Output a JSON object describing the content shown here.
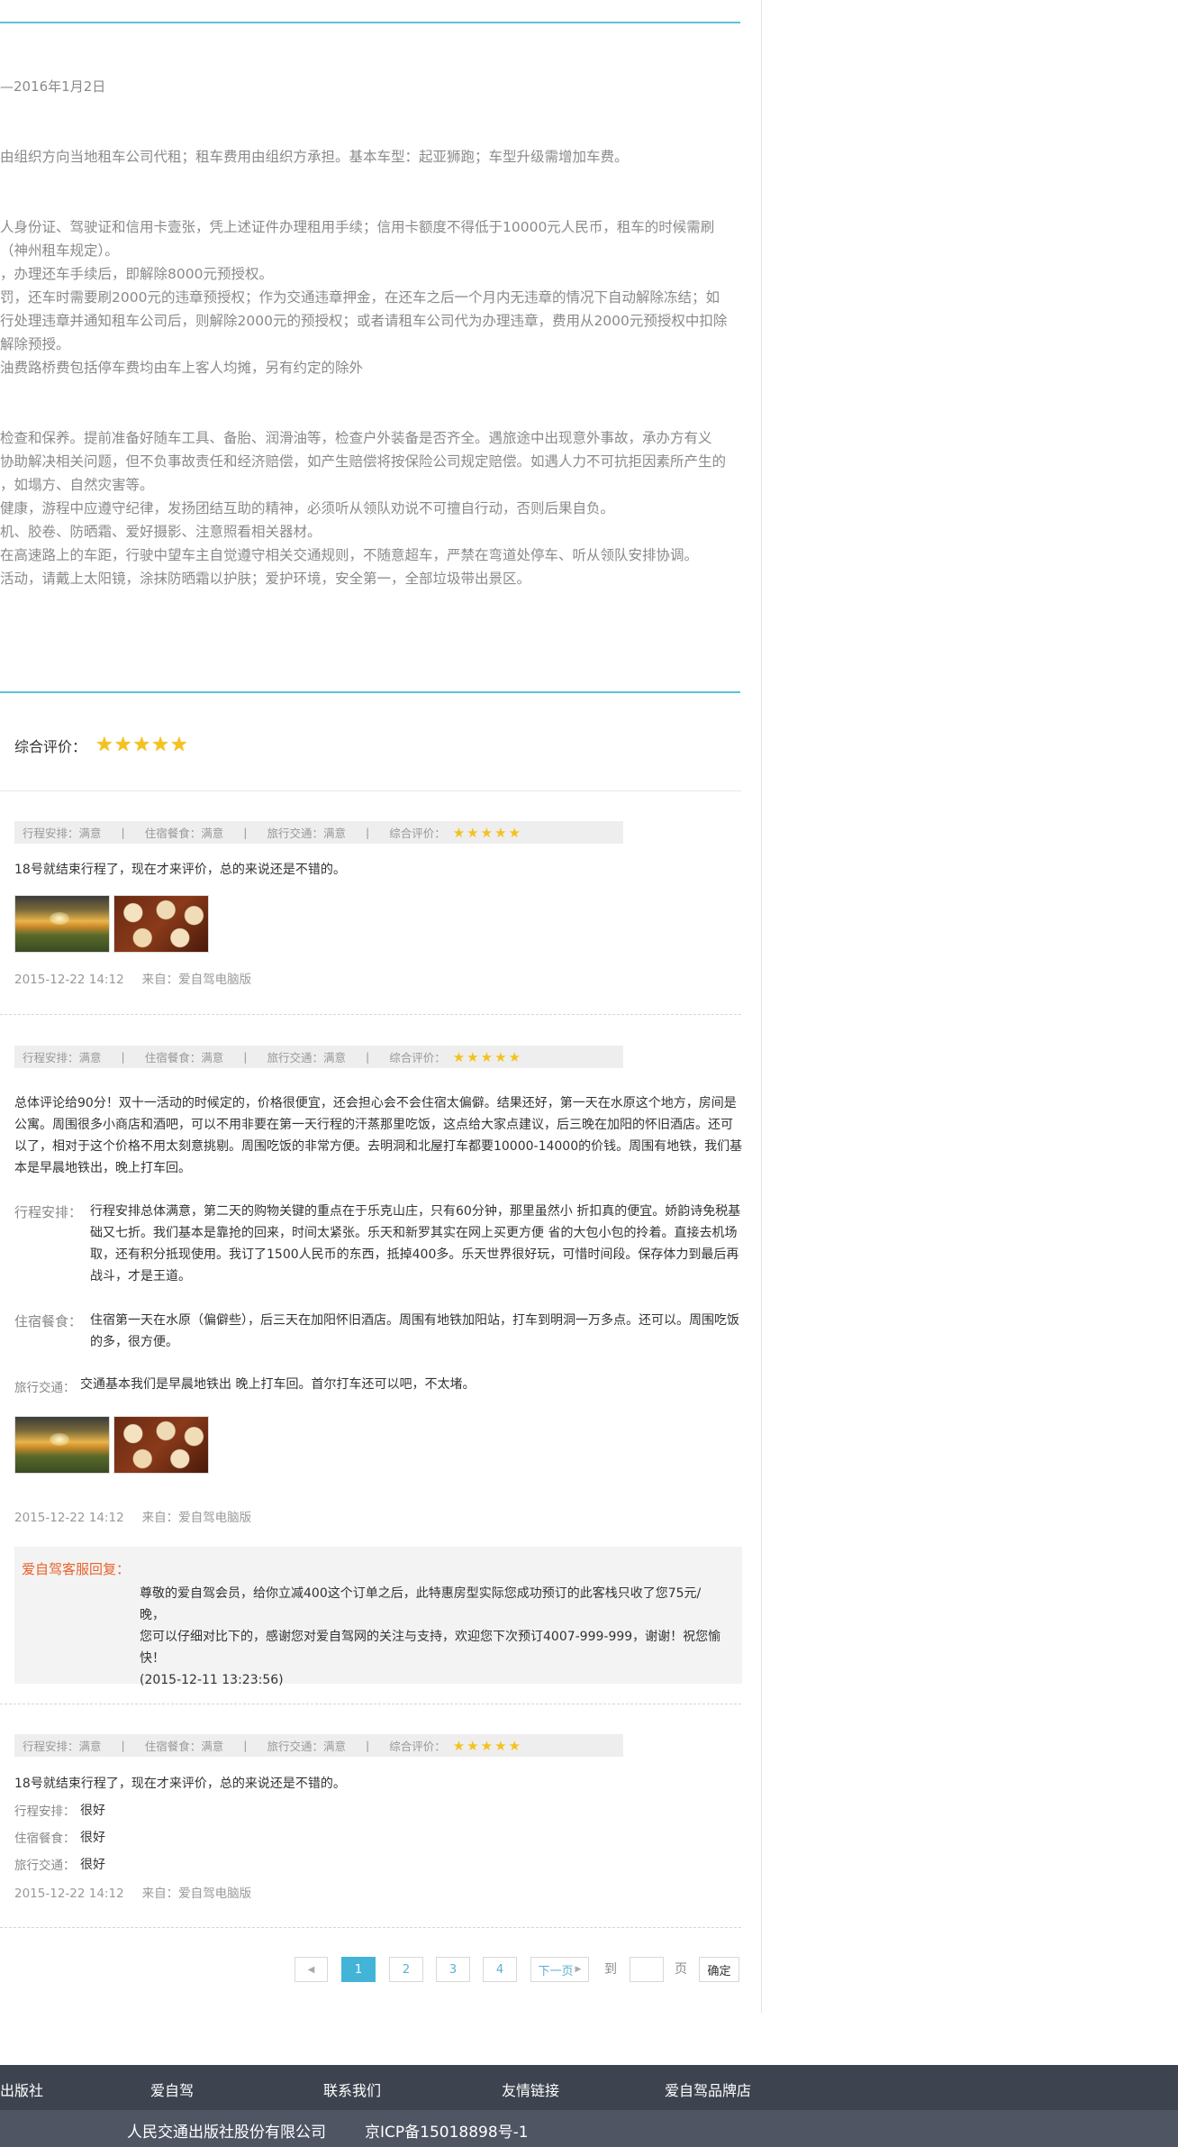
{
  "itinerary": {
    "date_range": "—2016年1月2日",
    "rules": [
      "由组织方向当地租车公司代租；租车费用由组织方承担。基本车型：起亚狮跑；车型升级需增加车费。",
      "",
      "",
      "人身份证、驾驶证和信用卡壹张，凭上述证件办理租用手续；信用卡额度不得低于10000元人民币，租车的时候需刷",
      "（神州租车规定）。",
      "，办理还车手续后，即解除8000元预授权。",
      "罚，还车时需要刷2000元的违章预授权；作为交通违章押金，在还车之后一个月内无违章的情况下自动解除冻结；如",
      "行处理违章并通知租车公司后，则解除2000元的预授权；或者请租车公司代为办理违章，费用从2000元预授权中扣除",
      "解除预授。",
      "油费路桥费包括停车费均由车上客人均摊，另有约定的除外",
      "",
      "",
      "检查和保养。提前准备好随车工具、备胎、润滑油等，检查户外装备是否齐全。遇旅途中出现意外事故，承办方有义",
      "协助解决相关问题，但不负事故责任和经济赔偿，如产生赔偿将按保险公司规定赔偿。如遇人力不可抗拒因素所产生的",
      "，如塌方、自然灾害等。",
      "健康，游程中应遵守纪律，发扬团结互助的精神，必须听从领队劝说不可擅自行动，否则后果自负。",
      "机、胶卷、防晒霜、爱好摄影、注意照看相关器材。",
      "在高速路上的车距，行驶中望车主自觉遵守相关交通规则，不随意超车，严禁在弯道处停车、听从领队安排协调。",
      "活动，请戴上太阳镜，涂抹防晒霜以护肤；爱护环境，安全第一，全部垃圾带出景区。"
    ]
  },
  "overall_rating": {
    "label": "综合评价：",
    "stars": 5
  },
  "rating_bar": {
    "itinerary": "行程安排：满意",
    "lodging": "住宿餐食：满意",
    "traffic": "旅行交通：满意",
    "overall": "综合评价："
  },
  "reviews": [
    {
      "text": "18号就结束行程了，现在才来评价，总的来说还是不错的。",
      "date": "2015-12-22 14:12",
      "source": "来自：爱自驾电脑版"
    },
    {
      "paragraph": [
        "总体评论给90分！双十一活动的时候定的，价格很便宜，还会担心会不会住宿太偏僻。结果还好，第一天在水原这个地方，房间是",
        "公寓。周围很多小商店和酒吧，可以不用非要在第一天行程的汗蒸那里吃饭，这点给大家点建议，后三晚在加阳的怀旧酒店。还可",
        "以了，相对于这个价格不用太刻意挑剔。周围吃饭的非常方便。去明洞和北屋打车都要10000-14000的价钱。周围有地铁，我们基",
        "本是早晨地铁出，晚上打车回。"
      ],
      "itinerary_label": "行程安排：",
      "itinerary_text": [
        "行程安排总体满意，第二天的购物关键的重点在于乐克山庄，只有60分钟，那里虽然小 折扣真的便宜。娇韵诗免税基",
        "础又七折。我们基本是靠抢的回来，时间太紧张。乐天和新罗其实在网上买更方便 省的大包小包的拎着。直接去机场",
        "取，还有积分抵现使用。我订了1500人民币的东西，抵掉400多。乐天世界很好玩，可惜时间段。保存体力到最后再",
        "战斗，才是王道。"
      ],
      "lodging_label": "住宿餐食：",
      "lodging_text": [
        "住宿第一天在水原（偏僻些），后三天在加阳怀旧酒店。周围有地铁加阳站，打车到明洞一万多点。还可以。周围吃饭",
        "的多，很方便。"
      ],
      "traffic_label": "旅行交通：",
      "traffic_text": "交通基本我们是早晨地铁出 晚上打车回。首尔打车还可以吧，不太堵。",
      "date": "2015-12-22 14:12",
      "source": "来自：爱自驾电脑版",
      "reply_label": "爱自驾客服回复：",
      "reply_lines": [
        "尊敬的爱自驾会员，给你立减400这个订单之后，此特惠房型实际您成功预订的此客栈只收了您75元/晚，",
        "您可以仔细对比下的，感谢您对爱自驾网的关注与支持，欢迎您下次预订4007-999-999，谢谢！祝您愉",
        "快！",
        "(2015-12-11 13:23:56)"
      ]
    },
    {
      "text": "18号就结束行程了，现在才来评价，总的来说还是不错的。",
      "itinerary_label": "行程安排：",
      "itinerary_value": "很好",
      "lodging_label": "住宿餐食：",
      "lodging_value": "很好",
      "traffic_label": "旅行交通：",
      "traffic_value": "很好",
      "date": "2015-12-22 14:12",
      "source": "来自：爱自驾电脑版"
    }
  ],
  "pagination": {
    "prev": "◀",
    "pages": [
      "1",
      "2",
      "3",
      "4"
    ],
    "current": "1",
    "next": "下一页",
    "to_label": "到",
    "page_label": "页",
    "confirm": "确定"
  },
  "footer": {
    "links": [
      "出版社",
      "爱自驾",
      "联系我们",
      "友情链接",
      "爱自驾品牌店"
    ],
    "company": "人民交通出版社股份有限公司",
    "icp": "京ICP备15018898号-1"
  },
  "colors": {
    "accent": "#5bc3d8",
    "reply_label": "#e8622a",
    "pager_active": "#43b4d8",
    "footer": "#3d434f"
  }
}
